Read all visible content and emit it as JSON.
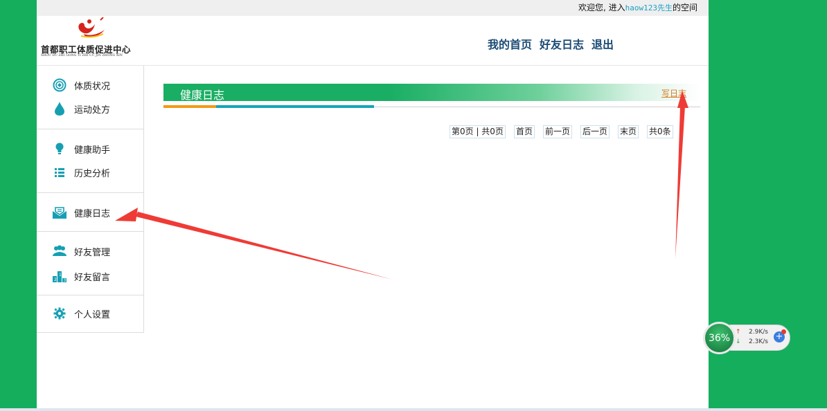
{
  "topbar": {
    "welcome_prefix": "欢迎您, 进入",
    "username": "haow123先生",
    "welcome_suffix": "的空间"
  },
  "logo": {
    "title": "首都职工体质促进中心",
    "subtitle": "SHOU DU ZHI GONG TI ZHI CU JIN ZHONG XIN"
  },
  "topnav": [
    "我的首页",
    "好友日志",
    "退出"
  ],
  "sidebar": {
    "items": [
      {
        "label": "体质状况",
        "icon": "ring-icon"
      },
      {
        "label": "运动处方",
        "icon": "drop-icon"
      },
      {
        "label": "健康助手",
        "icon": "bulb-icon"
      },
      {
        "label": "历史分析",
        "icon": "list-icon"
      },
      {
        "label": "健康日志",
        "icon": "envelope-icon"
      },
      {
        "label": "好友管理",
        "icon": "people-icon"
      },
      {
        "label": "好友留言",
        "icon": "podium-icon"
      },
      {
        "label": "个人设置",
        "icon": "gear-icon"
      }
    ]
  },
  "main": {
    "title": "健康日志",
    "write_link": "写日志",
    "pager": {
      "page_info": "第0页 | 共0页",
      "first": "首页",
      "prev": "前一页",
      "next": "后一页",
      "last": "末页",
      "total": "共0条"
    }
  },
  "speed_widget": {
    "percent": "36%",
    "upload": "2.9K/s",
    "download": "2.3K/s"
  },
  "colors": {
    "background": "#14ae5d",
    "nav_text": "#1b4a73",
    "accent_green": "#19ae63",
    "accent_orange": "#f29a14",
    "accent_teal": "#13a6b8",
    "link_orange": "#d9781e",
    "arrow_red": "#ef3b36"
  }
}
